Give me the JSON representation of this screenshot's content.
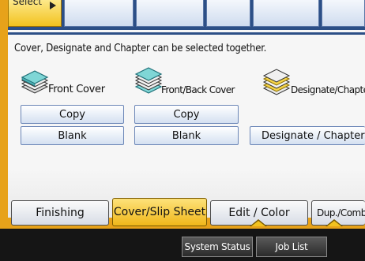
{
  "top_bar": {
    "select_label": "Select"
  },
  "message": "Cover, Designate and Chapter can be selected together.",
  "groups": [
    {
      "label": "Front Cover",
      "icon": "front-cover-stack-icon",
      "buttons": [
        "Copy",
        "Blank"
      ]
    },
    {
      "label": "Front/Back Cover",
      "icon": "front-back-cover-stack-icon",
      "buttons": [
        "Copy",
        "Blank"
      ]
    },
    {
      "label": "Designate/Chapter",
      "icon": "designate-chapter-stack-icon",
      "buttons": [
        "Designate / Chapter"
      ]
    }
  ],
  "tabs": [
    {
      "label": "Finishing",
      "active": false
    },
    {
      "label": "Cover/Slip Sheet",
      "active": true
    },
    {
      "label": "Edit / Color",
      "active": false
    },
    {
      "label": "Dup./Combine",
      "active": false
    }
  ],
  "footer": {
    "system_status": "System Status",
    "job_list": "Job List"
  },
  "colors": {
    "frame": "#e7a21a",
    "selected": "#f2c21f",
    "button_border": "#6b86b7",
    "footer_bg": "#151515"
  }
}
